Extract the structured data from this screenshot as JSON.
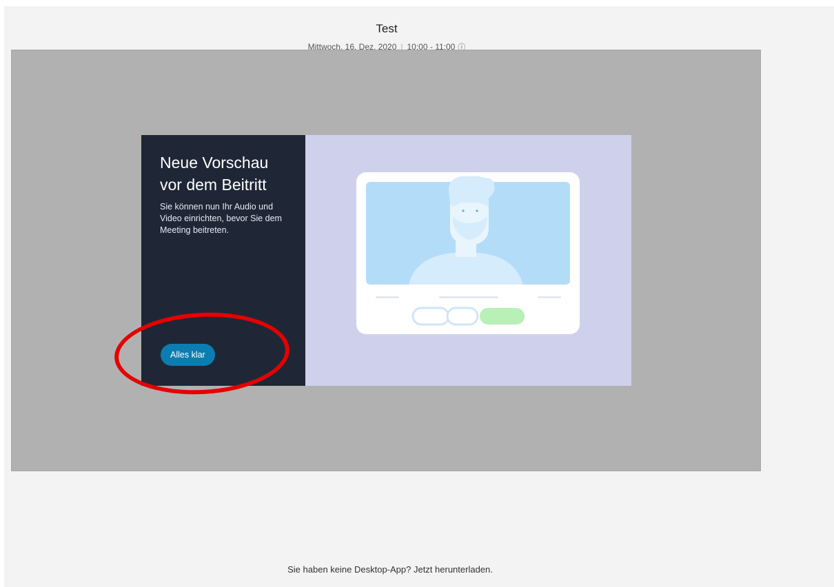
{
  "meeting": {
    "title": "Test",
    "day": "Mittwoch, 16. Dez. 2020",
    "time": "10:00 - 11:00",
    "info_icon": "info-icon"
  },
  "dialog": {
    "heading": "Neue Vorschau vor dem Beitritt",
    "description": "Sie können nun Ihr Audio und Video einrichten, bevor Sie dem Meeting beitreten.",
    "button_label": "Alles klar"
  },
  "footer": {
    "text": "Sie haben keine Desktop-App? Jetzt herunterladen."
  },
  "colors": {
    "dialog_dark": "#1f2736",
    "dialog_light": "#cfd1ec",
    "button": "#0b7db0",
    "highlight": "#e60000"
  }
}
